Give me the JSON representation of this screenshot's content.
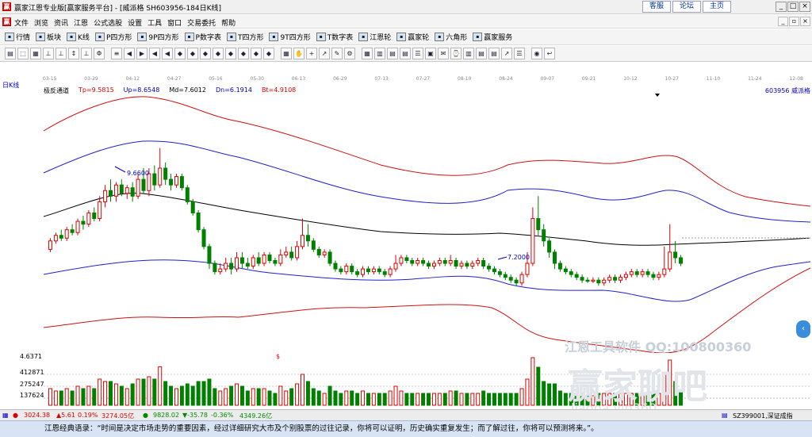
{
  "window": {
    "title": "赢家江恩专业版[赢家服务平台] - [威派格  SH603956-184日K线]",
    "links": [
      "客服",
      "论坛",
      "主页"
    ]
  },
  "menu": [
    "文件",
    "浏览",
    "资讯",
    "江恩",
    "公式选股",
    "设置",
    "工具",
    "窗口",
    "交易委托",
    "帮助"
  ],
  "toolbar_main": [
    "行情",
    "板块",
    "K线",
    "P四方形",
    "9P四方形",
    "P数字表",
    "T四方形",
    "9T四方形",
    "T数字表",
    "江恩轮",
    "赢家轮",
    "六角形",
    "赢家服务"
  ],
  "toolbar_main_icons": [
    "grid",
    "blocks",
    "candles",
    "p-square",
    "9p-square",
    "p-table",
    "t-square",
    "9t-square",
    "t-table",
    "gann-wheel",
    "winner-wheel",
    "hexagon",
    "service"
  ],
  "toolbar_tools": [
    "▤",
    "⬚",
    "▦",
    "⊥",
    "⊥",
    "↕",
    "⊥",
    "Φ",
    "≡",
    "◀",
    "▶",
    "◀",
    "◀",
    "◆",
    "◆",
    "◆",
    "◆",
    "◆",
    "◆",
    "◆",
    "◆",
    "▦",
    "✋",
    "+",
    "↗",
    "✎",
    "⚙",
    "▦",
    "▥",
    "▤",
    "▤",
    "☰",
    "▣",
    "✉",
    "⌚",
    "▥",
    "▤",
    "▤",
    "↗",
    "☰",
    "◉",
    "↩"
  ],
  "dates": [
    "03-15",
    "03-29",
    "04-12",
    "04-27",
    "05-16",
    "05-30",
    "06-13",
    "06-29",
    "07-13",
    "07-27",
    "08-10",
    "08-24",
    "09-07",
    "09-21",
    "10-12",
    "10-27",
    "11-10",
    "11-24",
    "12-08"
  ],
  "chart_label": "日K线",
  "indicator": {
    "name": "极反通道",
    "tp": "Tp=9.5815",
    "up": "Up=8.6548",
    "md": "Md=7.6012",
    "dn": "Dn=6.1914",
    "bt": "Bt=4.9108"
  },
  "stock": "603956  威派格",
  "annotations": {
    "high": "9.6600",
    "low": "7.2000",
    "marker": "$"
  },
  "volume_scale": [
    "4.6371",
    "412871",
    "275247",
    "137624"
  ],
  "watermark": {
    "line1": "江恩工具软件  QQ:100800360",
    "line2": "赢家聊吧",
    "line3": "liaoba.vip360"
  },
  "status": {
    "sh": "3024.38",
    "sh_chg": "▲5.61",
    "sh_pct": "0.19%",
    "sh_amt": "3274.05亿",
    "sz": "9828.02",
    "sz_chg": "▼-35.78",
    "sz_pct": "-0.36%",
    "sz_amt": "4349.26亿",
    "right": "SZ399001,深证成指"
  },
  "quote": "江恩经典语录：“时间是决定市场走势的重要因素，经过详细研究大市及个别股票的过往记录，你将可以证明，历史确实重复发生；而了解过往，你将可以预测将来。”。",
  "colors": {
    "up": "#e00000",
    "down": "#008000",
    "upper_band": "#d01010",
    "mid_band": "#2020d0",
    "ma": "#000000",
    "axis_label": "#0000cc"
  },
  "chart_data": {
    "type": "candlestick",
    "ylim": [
      6.0,
      10.4
    ],
    "candles_approx": [
      [
        7.85,
        8.0,
        8.05,
        7.8
      ],
      [
        8.0,
        8.1,
        8.15,
        7.95
      ],
      [
        8.1,
        8.05,
        8.2,
        8.0
      ],
      [
        8.05,
        8.2,
        8.25,
        8.0
      ],
      [
        8.2,
        8.15,
        8.3,
        8.1
      ],
      [
        8.15,
        8.35,
        8.4,
        8.1
      ],
      [
        8.35,
        8.3,
        8.45,
        8.2
      ],
      [
        8.3,
        8.5,
        8.55,
        8.25
      ],
      [
        8.5,
        8.4,
        8.6,
        8.35
      ],
      [
        8.4,
        8.7,
        8.8,
        8.35
      ],
      [
        8.7,
        8.9,
        9.0,
        8.6
      ],
      [
        8.9,
        8.8,
        9.1,
        8.7
      ],
      [
        8.8,
        9.0,
        9.05,
        8.7
      ],
      [
        9.0,
        8.85,
        9.1,
        8.8
      ],
      [
        8.85,
        8.95,
        9.0,
        8.75
      ],
      [
        8.95,
        8.8,
        9.05,
        8.7
      ],
      [
        8.8,
        9.1,
        9.2,
        8.75
      ],
      [
        9.1,
        8.9,
        9.3,
        8.85
      ],
      [
        8.9,
        9.2,
        9.3,
        8.8
      ],
      [
        9.2,
        9.0,
        9.35,
        8.9
      ],
      [
        9.0,
        9.3,
        9.66,
        8.95
      ],
      [
        9.3,
        9.1,
        9.4,
        9.0
      ],
      [
        9.1,
        9.0,
        9.2,
        8.9
      ],
      [
        9.0,
        9.15,
        9.2,
        8.95
      ],
      [
        9.15,
        8.95,
        9.2,
        8.9
      ],
      [
        8.95,
        8.7,
        9.0,
        8.65
      ],
      [
        8.7,
        8.5,
        8.75,
        8.45
      ],
      [
        8.5,
        8.2,
        8.55,
        8.15
      ],
      [
        8.2,
        7.9,
        8.25,
        7.85
      ],
      [
        7.9,
        7.6,
        7.95,
        7.5
      ],
      [
        7.6,
        7.45,
        7.65,
        7.4
      ],
      [
        7.45,
        7.5,
        7.6,
        7.4
      ],
      [
        7.5,
        7.6,
        7.7,
        7.45
      ],
      [
        7.6,
        7.5,
        7.7,
        7.4
      ],
      [
        7.5,
        7.7,
        7.8,
        7.45
      ],
      [
        7.7,
        7.6,
        7.8,
        7.5
      ],
      [
        7.6,
        7.55,
        7.7,
        7.5
      ],
      [
        7.55,
        7.7,
        7.75,
        7.5
      ],
      [
        7.7,
        7.6,
        7.8,
        7.55
      ],
      [
        7.6,
        7.75,
        7.8,
        7.55
      ],
      [
        7.75,
        7.65,
        7.8,
        7.6
      ],
      [
        7.65,
        7.6,
        7.7,
        7.55
      ],
      [
        7.6,
        7.75,
        7.85,
        7.55
      ],
      [
        7.75,
        7.8,
        7.9,
        7.7
      ],
      [
        7.8,
        7.7,
        7.9,
        7.65
      ],
      [
        7.7,
        7.9,
        8.0,
        7.65
      ],
      [
        7.9,
        8.1,
        8.4,
        7.85
      ],
      [
        8.1,
        8.0,
        8.3,
        7.9
      ],
      [
        8.0,
        7.85,
        8.05,
        7.8
      ],
      [
        7.85,
        7.75,
        7.9,
        7.7
      ],
      [
        7.75,
        7.8,
        7.85,
        7.7
      ],
      [
        7.8,
        7.6,
        7.85,
        7.55
      ],
      [
        7.6,
        7.5,
        7.65,
        7.45
      ],
      [
        7.5,
        7.45,
        7.55,
        7.4
      ],
      [
        7.45,
        7.55,
        7.6,
        7.4
      ],
      [
        7.55,
        7.45,
        7.6,
        7.4
      ],
      [
        7.45,
        7.4,
        7.5,
        7.35
      ],
      [
        7.4,
        7.5,
        7.55,
        7.35
      ],
      [
        7.5,
        7.45,
        7.55,
        7.4
      ],
      [
        7.45,
        7.5,
        7.55,
        7.4
      ],
      [
        7.5,
        7.45,
        7.55,
        7.4
      ],
      [
        7.45,
        7.4,
        7.5,
        7.35
      ],
      [
        7.4,
        7.5,
        7.55,
        7.35
      ],
      [
        7.5,
        7.6,
        7.75,
        7.45
      ],
      [
        7.6,
        7.7,
        7.75,
        7.55
      ],
      [
        7.7,
        7.65,
        7.75,
        7.6
      ],
      [
        7.65,
        7.6,
        7.7,
        7.55
      ],
      [
        7.6,
        7.65,
        7.7,
        7.55
      ],
      [
        7.65,
        7.6,
        7.7,
        7.55
      ],
      [
        7.6,
        7.55,
        7.65,
        7.5
      ],
      [
        7.55,
        7.6,
        7.65,
        7.5
      ],
      [
        7.6,
        7.65,
        7.7,
        7.55
      ],
      [
        7.65,
        7.6,
        7.7,
        7.55
      ],
      [
        7.6,
        7.65,
        7.75,
        7.55
      ],
      [
        7.65,
        7.55,
        7.7,
        7.5
      ],
      [
        7.55,
        7.6,
        7.65,
        7.5
      ],
      [
        7.6,
        7.55,
        7.65,
        7.5
      ],
      [
        7.55,
        7.6,
        7.65,
        7.5
      ],
      [
        7.6,
        7.65,
        7.7,
        7.55
      ],
      [
        7.65,
        7.55,
        7.7,
        7.5
      ],
      [
        7.55,
        7.5,
        7.6,
        7.45
      ],
      [
        7.5,
        7.45,
        7.55,
        7.4
      ],
      [
        7.45,
        7.4,
        7.5,
        7.35
      ],
      [
        7.4,
        7.35,
        7.45,
        7.3
      ],
      [
        7.35,
        7.3,
        7.4,
        7.25
      ],
      [
        7.3,
        7.25,
        7.35,
        7.2
      ],
      [
        7.25,
        7.4,
        7.45,
        7.2
      ],
      [
        7.4,
        7.6,
        7.8,
        7.35
      ],
      [
        7.6,
        8.4,
        8.6,
        7.55
      ],
      [
        8.4,
        8.2,
        8.8,
        8.1
      ],
      [
        8.2,
        8.0,
        8.3,
        7.9
      ],
      [
        8.0,
        7.8,
        8.05,
        7.7
      ],
      [
        7.8,
        7.6,
        7.85,
        7.5
      ],
      [
        7.6,
        7.5,
        7.65,
        7.45
      ],
      [
        7.5,
        7.45,
        7.55,
        7.4
      ],
      [
        7.45,
        7.4,
        7.5,
        7.35
      ],
      [
        7.4,
        7.35,
        7.45,
        7.3
      ],
      [
        7.35,
        7.3,
        7.4,
        7.25
      ],
      [
        7.3,
        7.28,
        7.35,
        7.25
      ],
      [
        7.28,
        7.3,
        7.35,
        7.25
      ],
      [
        7.3,
        7.25,
        7.35,
        7.2
      ],
      [
        7.25,
        7.3,
        7.35,
        7.2
      ],
      [
        7.3,
        7.35,
        7.4,
        7.25
      ],
      [
        7.35,
        7.3,
        7.4,
        7.25
      ],
      [
        7.3,
        7.35,
        7.4,
        7.25
      ],
      [
        7.35,
        7.4,
        7.45,
        7.3
      ],
      [
        7.4,
        7.45,
        7.5,
        7.35
      ],
      [
        7.45,
        7.4,
        7.5,
        7.35
      ],
      [
        7.4,
        7.45,
        7.5,
        7.35
      ],
      [
        7.45,
        7.4,
        7.5,
        7.35
      ],
      [
        7.4,
        7.35,
        7.45,
        7.3
      ],
      [
        7.35,
        7.4,
        7.45,
        7.3
      ],
      [
        7.4,
        7.5,
        7.9,
        7.35
      ],
      [
        7.5,
        7.8,
        8.3,
        7.45
      ],
      [
        7.8,
        7.7,
        8.0,
        7.6
      ],
      [
        7.7,
        7.6,
        7.75,
        7.55
      ]
    ],
    "channel_note": "upper(red) and lower(red) bands, inner blue bands, black moving average"
  }
}
